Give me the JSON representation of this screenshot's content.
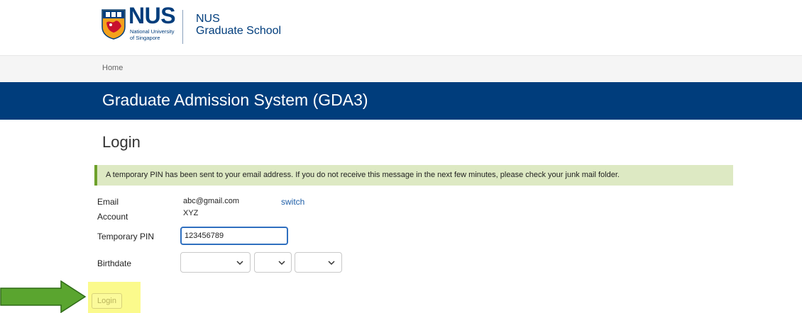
{
  "logo": {
    "brand": "NUS",
    "university_line1": "National University",
    "university_line2": "of Singapore"
  },
  "school": {
    "line1": "NUS",
    "line2": "Graduate School"
  },
  "breadcrumb": {
    "home": "Home"
  },
  "banner": {
    "title": "Graduate Admission System (GDA3)"
  },
  "login": {
    "heading": "Login",
    "alert": "A temporary PIN has been sent to your email address. If you do not receive this message in the next few minutes, please check your junk mail folder.",
    "email_label": "Email",
    "email_value": "abc@gmail.com",
    "switch_label": "switch",
    "account_label": "Account",
    "account_value": "XYZ",
    "pin_label": "Temporary PIN",
    "pin_value": "123456789",
    "birthdate_label": "Birthdate",
    "birthdate_day": "",
    "birthdate_month": "",
    "birthdate_year": "",
    "submit_label": "Login"
  },
  "colors": {
    "brand_blue": "#003d7c",
    "alert_bg": "#dde9c3",
    "alert_border": "#6ea12b",
    "highlight_yellow": "#fbfa8c",
    "arrow_green": "#5aa52f",
    "link_blue": "#1f5fa8"
  },
  "icons": {
    "crest": "nus-crest-icon",
    "dropdown": "chevron-down-icon",
    "annotation": "right-arrow-icon"
  }
}
